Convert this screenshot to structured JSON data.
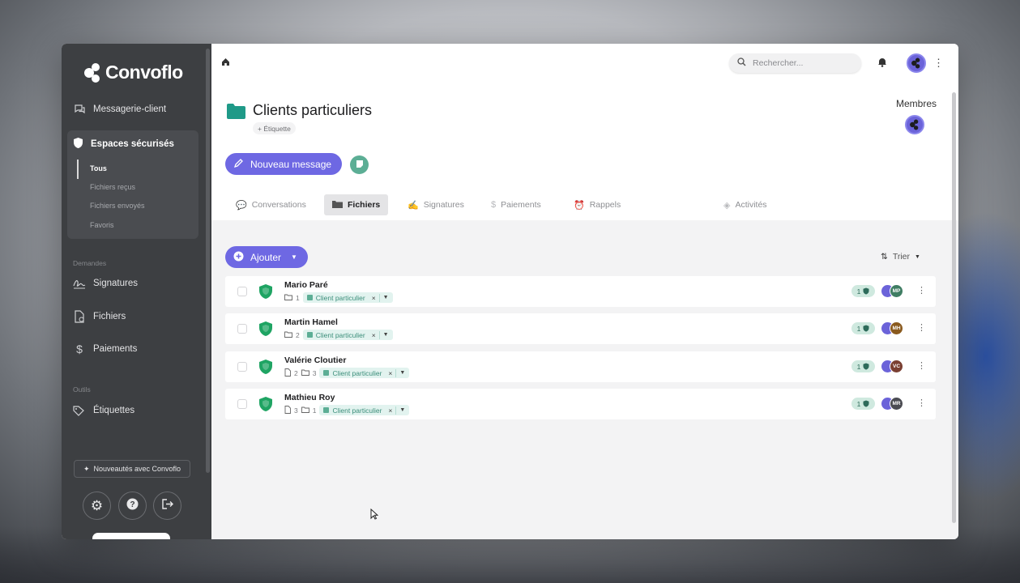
{
  "app": {
    "logo_text": "Convoflo",
    "accent": "#6e68e3",
    "green": "#1fa463"
  },
  "sidebar": {
    "items": [
      {
        "label": "Messagerie-client",
        "icon": "chat-icon"
      },
      {
        "label": "Espaces sécurisés",
        "icon": "shield-icon"
      }
    ],
    "secure_sub": [
      "Tous",
      "Fichiers reçus",
      "Fichiers envoyés",
      "Favoris"
    ],
    "section_requests": "Demandes",
    "requests": [
      {
        "label": "Signatures",
        "icon": "signature-icon"
      },
      {
        "label": "Fichiers",
        "icon": "file-icon"
      },
      {
        "label": "Paiements",
        "icon": "dollar-icon"
      }
    ],
    "section_tools": "Outils",
    "tools": [
      {
        "label": "Étiquettes",
        "icon": "tag-icon"
      }
    ],
    "news_label": "Nouveautés avec Convoflo"
  },
  "header": {
    "search_placeholder": "Rechercher...",
    "title": "Clients particuliers",
    "tag_add": "+ Étiquette",
    "members_label": "Membres",
    "new_message_label": "Nouveau message"
  },
  "tabs": [
    {
      "label": "Conversations",
      "icon": "conversations-icon"
    },
    {
      "label": "Fichiers",
      "icon": "folder-icon"
    },
    {
      "label": "Signatures",
      "icon": "signature-icon"
    },
    {
      "label": "Paiements",
      "icon": "dollar-icon"
    },
    {
      "label": "Rappels",
      "icon": "reminder-icon"
    },
    {
      "label": "Activités",
      "icon": "activity-icon"
    }
  ],
  "toolbar": {
    "add_label": "Ajouter",
    "sort_label": "Trier"
  },
  "rows": [
    {
      "name": "Mario Paré",
      "docs": "",
      "folders": "1",
      "tag": "Client particulier",
      "count": "1",
      "initials": "MP",
      "avatar_color": "#3f7d63"
    },
    {
      "name": "Martin Hamel",
      "docs": "",
      "folders": "2",
      "tag": "Client particulier",
      "count": "1",
      "initials": "MH",
      "avatar_color": "#8a5a1e"
    },
    {
      "name": "Valérie Cloutier",
      "docs": "2",
      "folders": "3",
      "tag": "Client particulier",
      "count": "1",
      "initials": "VC",
      "avatar_color": "#7a3f32"
    },
    {
      "name": "Mathieu Roy",
      "docs": "3",
      "folders": "1",
      "tag": "Client particulier",
      "count": "1",
      "initials": "MR",
      "avatar_color": "#4a4b52"
    }
  ]
}
